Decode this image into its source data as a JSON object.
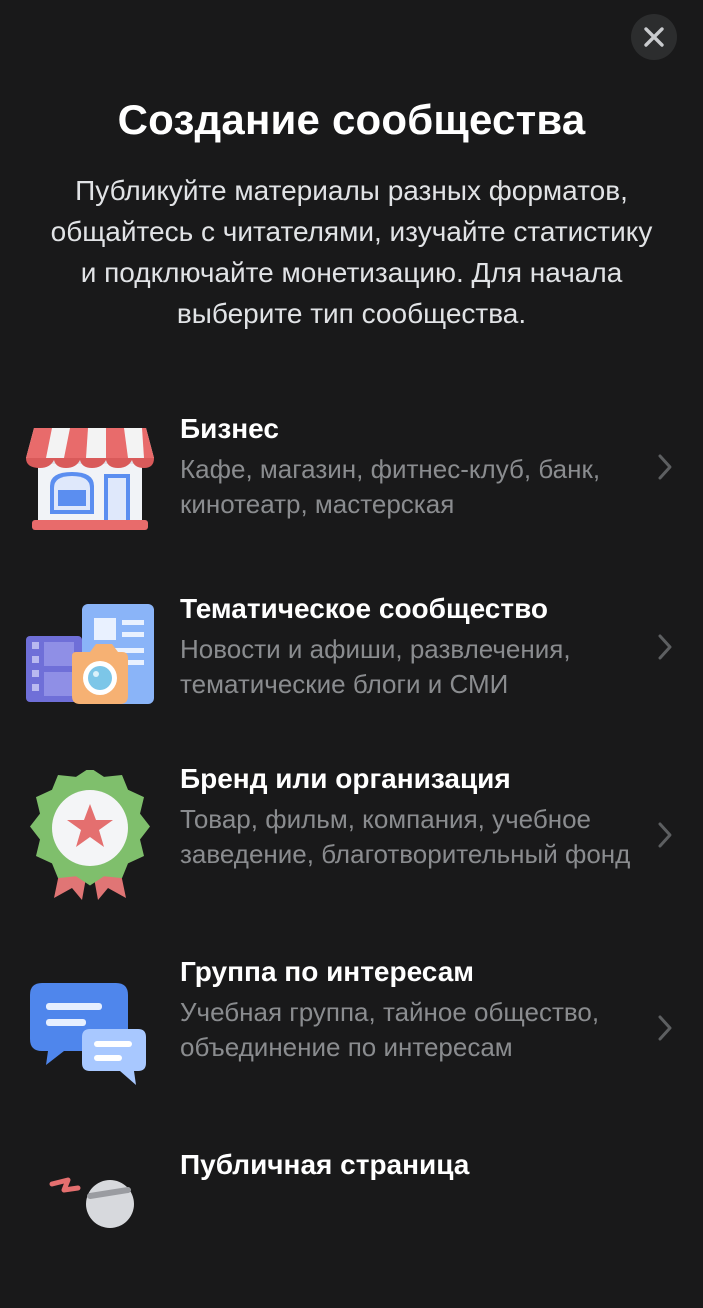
{
  "header": {
    "title": "Создание сообщества",
    "subtitle": "Публикуйте материалы разных форматов, общайтесь с читателями, изучайте статистику и подключайте монетизацию. Для начала выберите тип сообщества."
  },
  "close_icon": "close-icon",
  "items": [
    {
      "title": "Бизнес",
      "desc": "Кафе, магазин, фитнес-клуб, банк, кинотеатр, мастерская",
      "icon": "store-icon"
    },
    {
      "title": "Тематическое сообщество",
      "desc": "Новости и афиши, развлечения, тематические блоги и СМИ",
      "icon": "media-icon"
    },
    {
      "title": "Бренд или организация",
      "desc": "Товар, фильм, компания, учебное заведение, благотворительный фонд",
      "icon": "badge-icon"
    },
    {
      "title": "Группа по интересам",
      "desc": "Учебная группа, тайное общество, объединение по интересам",
      "icon": "chat-icon"
    },
    {
      "title": "Публичная страница",
      "desc": "",
      "icon": "public-page-icon"
    }
  ],
  "colors": {
    "background": "#19191a",
    "close_button_bg": "#2c2d2e",
    "title": "#ffffff",
    "description": "#8a8c8f",
    "chevron": "#5d5f61"
  }
}
